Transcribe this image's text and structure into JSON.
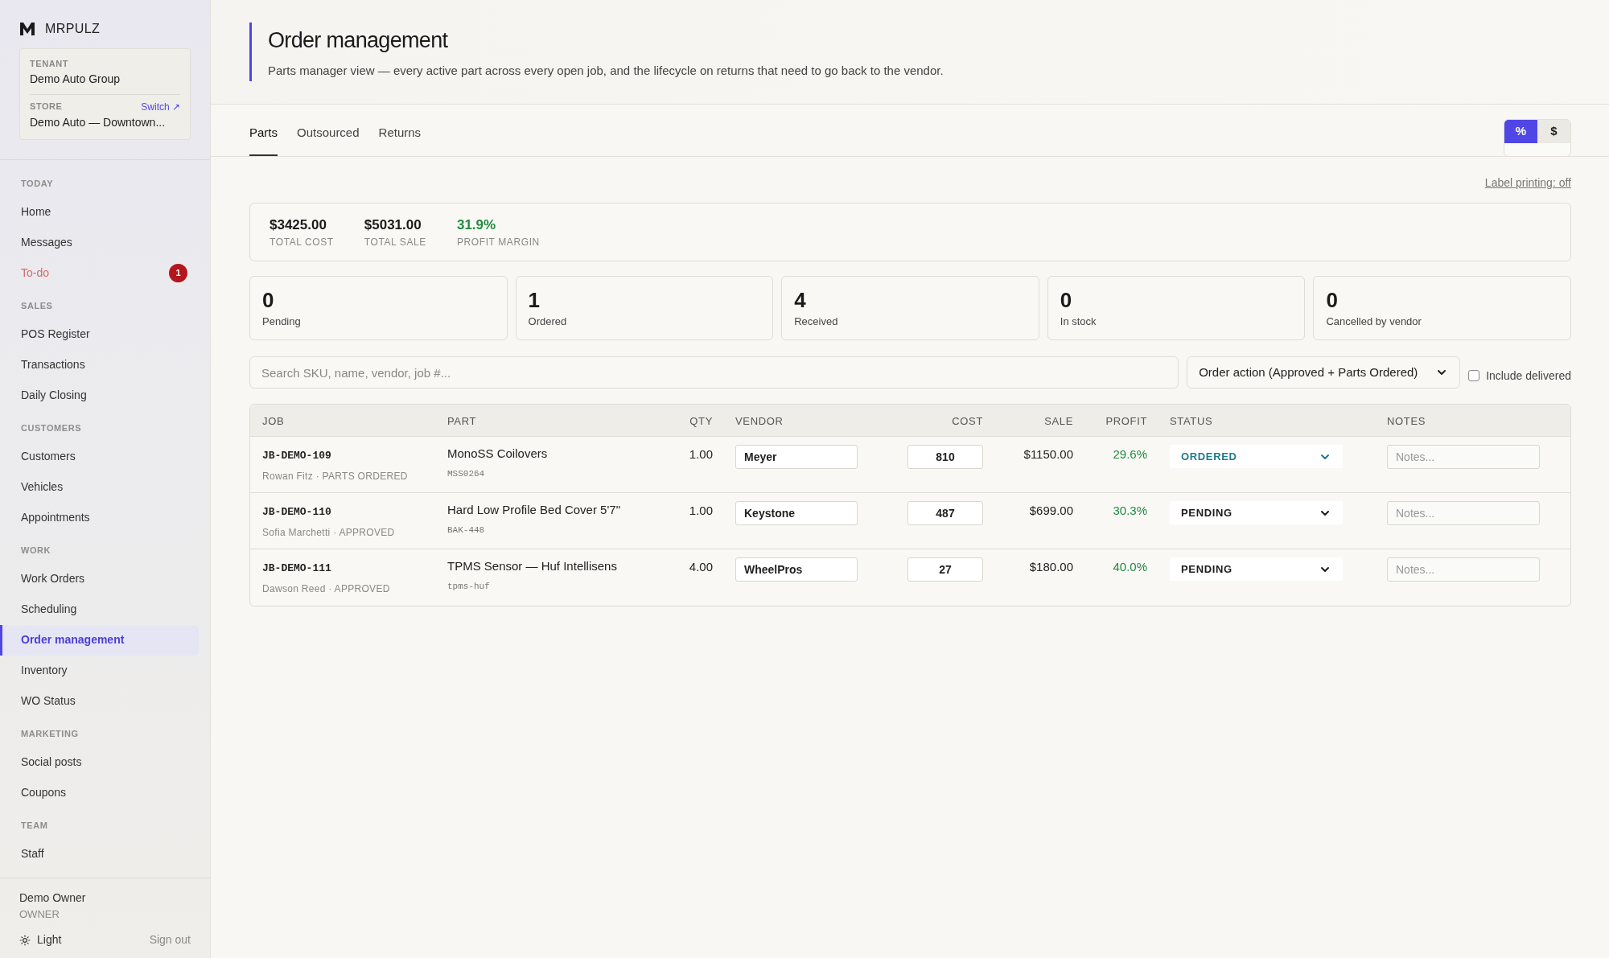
{
  "brand": {
    "name": "MRPULZ"
  },
  "tenant": {
    "label": "TENANT",
    "name": "Demo Auto Group",
    "store_label": "STORE",
    "store_link": "Switch ↗",
    "store_name": "Demo Auto — Downtown..."
  },
  "nav": [
    {
      "heading": "TODAY",
      "items": [
        {
          "label": "Home",
          "selected": false,
          "alert": false
        },
        {
          "label": "Messages",
          "selected": false,
          "alert": false
        },
        {
          "label": "To-do",
          "selected": false,
          "alert": true,
          "badge": "1"
        }
      ]
    },
    {
      "heading": "SALES",
      "items": [
        {
          "label": "POS Register",
          "selected": false,
          "alert": false
        },
        {
          "label": "Transactions",
          "selected": false,
          "alert": false
        },
        {
          "label": "Daily Closing",
          "selected": false,
          "alert": false
        }
      ]
    },
    {
      "heading": "CUSTOMERS",
      "items": [
        {
          "label": "Customers",
          "selected": false,
          "alert": false
        },
        {
          "label": "Vehicles",
          "selected": false,
          "alert": false
        },
        {
          "label": "Appointments",
          "selected": false,
          "alert": false
        }
      ]
    },
    {
      "heading": "WORK",
      "items": [
        {
          "label": "Work Orders",
          "selected": false,
          "alert": false
        },
        {
          "label": "Scheduling",
          "selected": false,
          "alert": false
        },
        {
          "label": "Order management",
          "selected": true,
          "alert": false
        },
        {
          "label": "Inventory",
          "selected": false,
          "alert": false
        },
        {
          "label": "WO Status",
          "selected": false,
          "alert": false
        }
      ]
    },
    {
      "heading": "MARKETING",
      "items": [
        {
          "label": "Social posts",
          "selected": false,
          "alert": false
        },
        {
          "label": "Coupons",
          "selected": false,
          "alert": false
        }
      ]
    },
    {
      "heading": "TEAM",
      "items": [
        {
          "label": "Staff",
          "selected": false,
          "alert": false
        }
      ]
    }
  ],
  "user": {
    "name": "Demo Owner",
    "role": "OWNER",
    "theme": "Light",
    "sign_out": "Sign out"
  },
  "header": {
    "title": "Order management",
    "subtitle": "Parts manager view — every active part across every open job, and the lifecycle on returns that need to go back to the vendor."
  },
  "tabs": [
    {
      "label": "Parts",
      "selected": true
    },
    {
      "label": "Outsourced",
      "selected": false
    },
    {
      "label": "Returns",
      "selected": false
    }
  ],
  "mode_toggle": [
    {
      "label": "%",
      "selected": true
    },
    {
      "label": "$",
      "selected": false
    }
  ],
  "label_printing": "Label printing: off",
  "summary": [
    {
      "value": "$3425.00",
      "label": "TOTAL COST",
      "positive": false
    },
    {
      "value": "$5031.00",
      "label": "TOTAL SALE",
      "positive": false
    },
    {
      "value": "31.9%",
      "label": "PROFIT MARGIN",
      "positive": true
    }
  ],
  "status_counts": [
    {
      "count": "0",
      "label": "Pending"
    },
    {
      "count": "1",
      "label": "Ordered"
    },
    {
      "count": "4",
      "label": "Received"
    },
    {
      "count": "0",
      "label": "In stock"
    },
    {
      "count": "0",
      "label": "Cancelled by vendor"
    }
  ],
  "search": {
    "placeholder": "Search SKU, name, vendor, job #..."
  },
  "order_action": {
    "value": "Order action (Approved + Parts Ordered)"
  },
  "include_delivered": {
    "label": "Include delivered",
    "checked": false
  },
  "table": {
    "columns": [
      "JOB",
      "PART",
      "QTY",
      "VENDOR",
      "COST",
      "SALE",
      "PROFIT",
      "STATUS",
      "NOTES"
    ],
    "rows": [
      {
        "job": "JB-DEMO-109",
        "customer": "Rowan Fitz · PARTS ORDERED",
        "part": "MonoSS Coilovers",
        "sku": "MSS0264",
        "qty": "1.00",
        "vendor": "Meyer",
        "cost": "810",
        "sale": "$1150.00",
        "profit": "29.6%",
        "status": "ORDERED",
        "color": "#1f7a8c",
        "notes_placeholder": "Notes..."
      },
      {
        "job": "JB-DEMO-110",
        "customer": "Sofia Marchetti · APPROVED",
        "part": "Hard Low Profile Bed Cover 5'7\"",
        "sku": "BAK-448",
        "qty": "1.00",
        "vendor": "Keystone",
        "cost": "487",
        "sale": "$699.00",
        "profit": "30.3%",
        "status": "PENDING",
        "color": "#1c1c1c",
        "notes_placeholder": "Notes..."
      },
      {
        "job": "JB-DEMO-111",
        "customer": "Dawson Reed · APPROVED",
        "part": "TPMS Sensor — Huf Intellisens",
        "sku": "tpms-huf",
        "qty": "4.00",
        "vendor": "WheelPros",
        "cost": "27",
        "sale": "$180.00",
        "profit": "40.0%",
        "status": "PENDING",
        "color": "#1c1c1c",
        "notes_placeholder": "Notes..."
      }
    ]
  }
}
